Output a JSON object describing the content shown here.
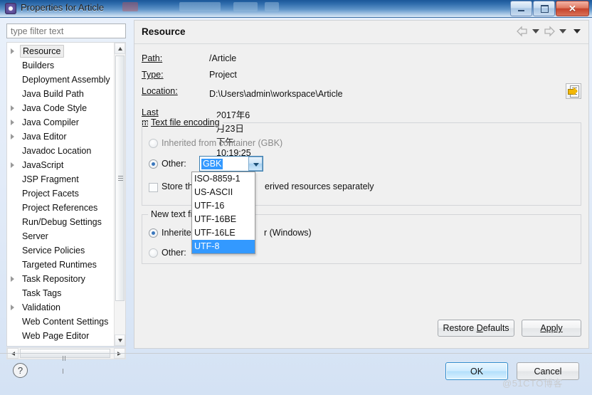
{
  "window": {
    "title": "Properties for Article",
    "icon": "eclipse-properties-icon",
    "buttons": {
      "minimize": "minimize",
      "maximize": "maximize",
      "close": "✕"
    }
  },
  "filter": {
    "placeholder": "type filter text",
    "value": ""
  },
  "tree": {
    "items": [
      {
        "label": "Resource",
        "expandable": true,
        "selected": true
      },
      {
        "label": "Builders",
        "expandable": false,
        "selected": false
      },
      {
        "label": "Deployment Assembly",
        "expandable": false,
        "selected": false
      },
      {
        "label": "Java Build Path",
        "expandable": false,
        "selected": false
      },
      {
        "label": "Java Code Style",
        "expandable": true,
        "selected": false
      },
      {
        "label": "Java Compiler",
        "expandable": true,
        "selected": false
      },
      {
        "label": "Java Editor",
        "expandable": true,
        "selected": false
      },
      {
        "label": "Javadoc Location",
        "expandable": false,
        "selected": false
      },
      {
        "label": "JavaScript",
        "expandable": true,
        "selected": false
      },
      {
        "label": "JSP Fragment",
        "expandable": false,
        "selected": false
      },
      {
        "label": "Project Facets",
        "expandable": false,
        "selected": false
      },
      {
        "label": "Project References",
        "expandable": false,
        "selected": false
      },
      {
        "label": "Run/Debug Settings",
        "expandable": false,
        "selected": false
      },
      {
        "label": "Server",
        "expandable": false,
        "selected": false
      },
      {
        "label": "Service Policies",
        "expandable": false,
        "selected": false
      },
      {
        "label": "Targeted Runtimes",
        "expandable": false,
        "selected": false
      },
      {
        "label": "Task Repository",
        "expandable": true,
        "selected": false
      },
      {
        "label": "Task Tags",
        "expandable": false,
        "selected": false
      },
      {
        "label": "Validation",
        "expandable": true,
        "selected": false
      },
      {
        "label": "Web Content Settings",
        "expandable": false,
        "selected": false
      },
      {
        "label": "Web Page Editor",
        "expandable": false,
        "selected": false
      }
    ]
  },
  "page": {
    "title": "Resource",
    "nav": {
      "back_icon": "arrow-left-icon",
      "back_menu_icon": "chevron-down-icon",
      "forward_icon": "arrow-right-icon",
      "forward_menu_icon": "chevron-down-icon",
      "view_menu_icon": "chevron-down-filled-icon"
    },
    "fields": [
      {
        "label": "Path:",
        "value": "/Article"
      },
      {
        "label": "Type:",
        "value": "Project"
      },
      {
        "label": "Location:",
        "value": "D:\\Users\\admin\\workspace\\Article"
      }
    ],
    "last_modified": {
      "label": "Last modified:",
      "value": "2017年6月23日 下午10:19:25"
    },
    "resolve_button_icon": "resolve-link-icon",
    "encoding_group": {
      "legend": "Text file encoding",
      "inherited_label": "Inherited from container (GBK)",
      "inherited_selected": false,
      "other_label": "Other:",
      "other_selected": true,
      "combo_value": "GBK",
      "combo_caret_icon": "chevron-down-icon",
      "dropdown_options": [
        "ISO-8859-1",
        "US-ASCII",
        "UTF-16",
        "UTF-16BE",
        "UTF-16LE",
        "UTF-8"
      ],
      "dropdown_selected": "UTF-8",
      "store_checkbox_label": "Store th",
      "store_checkbox_label_tail": "erived resources separately",
      "store_checked": false
    },
    "delimiter_group": {
      "legend_head": "New text fi",
      "inherited_label_head": "Inherite",
      "inherited_label_tail": "r (Windows)",
      "inherited_selected": true,
      "other_label": "Other:",
      "other_selected": false
    }
  },
  "buttons": {
    "restore_defaults": "Restore Defaults",
    "apply": "Apply",
    "ok": "OK",
    "cancel": "Cancel",
    "help_icon": "question-mark-icon"
  },
  "watermark": "@51CTO博客"
}
